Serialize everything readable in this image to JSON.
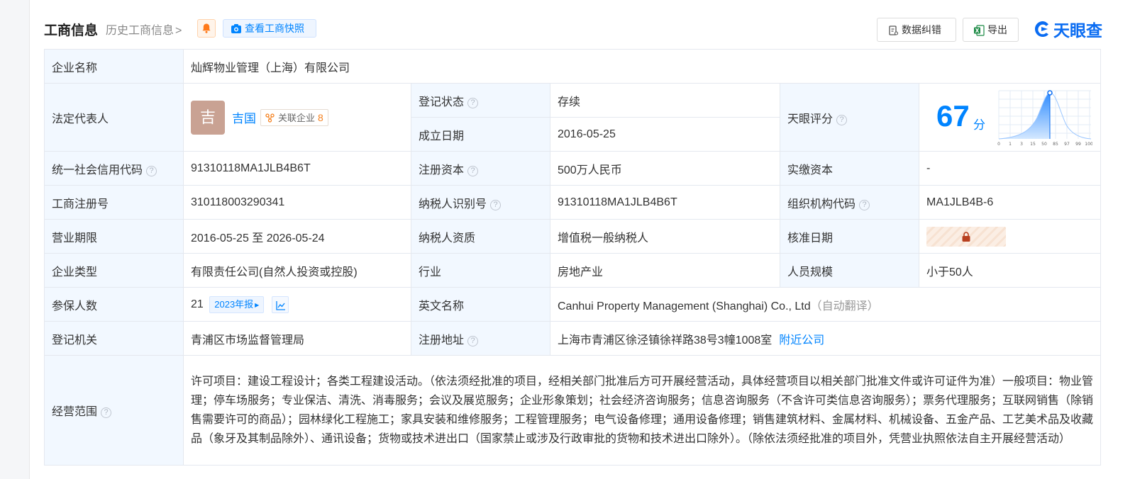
{
  "header": {
    "title": "工商信息",
    "history_link": "历史工商信息",
    "history_chevron": ">",
    "snapshot_button": "查看工商快照",
    "correct_button": "数据纠错",
    "export_button": "导出",
    "logo_text": "天眼查"
  },
  "colors": {
    "accent": "#0084ff",
    "label_bg": "#f2f8ff",
    "status_green": "#1aa33e",
    "orange": "#f58220"
  },
  "rows": {
    "company_name": {
      "label": "企业名称",
      "value": "灿辉物业管理（上海）有限公司"
    },
    "legal_rep": {
      "label": "法定代表人",
      "avatar_char": "吉",
      "name": "吉国",
      "related_label": "关联企业",
      "related_count": "8"
    },
    "reg_status": {
      "label": "登记状态",
      "value": "存续"
    },
    "founded": {
      "label": "成立日期",
      "value": "2016-05-25"
    },
    "tianyan_score": {
      "label": "天眼评分",
      "score": "67",
      "unit": "分",
      "ticks": [
        "0",
        "1",
        "3",
        "15",
        "50",
        "85",
        "97",
        "99",
        "100"
      ]
    },
    "credit_code": {
      "label": "统一社会信用代码",
      "value": "91310118MA1JLB4B6T"
    },
    "reg_capital": {
      "label": "注册资本",
      "value": "500万人民币"
    },
    "paid_capital": {
      "label": "实缴资本",
      "value": "-"
    },
    "reg_number": {
      "label": "工商注册号",
      "value": "310118003290341"
    },
    "taxpayer_id": {
      "label": "纳税人识别号",
      "value": "91310118MA1JLB4B6T"
    },
    "org_code": {
      "label": "组织机构代码",
      "value": "MA1JLB4B-6"
    },
    "business_term": {
      "label": "营业期限",
      "value": "2016-05-25 至 2026-05-24"
    },
    "taxpayer_qual": {
      "label": "纳税人资质",
      "value": "增值税一般纳税人"
    },
    "approval_date": {
      "label": "核准日期"
    },
    "company_type": {
      "label": "企业类型",
      "value": "有限责任公司(自然人投资或控股)"
    },
    "industry": {
      "label": "行业",
      "value": "房地产业"
    },
    "staff_size": {
      "label": "人员规模",
      "value": "小于50人"
    },
    "insured": {
      "label": "参保人数",
      "value": "21",
      "report_tag": "2023年报"
    },
    "english_name": {
      "label": "英文名称",
      "value": "Canhui Property Management (Shanghai) Co., Ltd",
      "note": "（自动翻译）"
    },
    "reg_authority": {
      "label": "登记机关",
      "value": "青浦区市场监督管理局"
    },
    "reg_address": {
      "label": "注册地址",
      "value": "上海市青浦区徐泾镇徐祥路38号3幢1008室",
      "nearby": "附近公司"
    },
    "scope": {
      "label": "经营范围",
      "value": "许可项目：建设工程设计；各类工程建设活动。（依法须经批准的项目，经相关部门批准后方可开展经营活动，具体经营项目以相关部门批准文件或许可证件为准）一般项目：物业管理；停车场服务；专业保洁、清洗、消毒服务；会议及展览服务；企业形象策划；社会经济咨询服务；信息咨询服务（不含许可类信息咨询服务）；票务代理服务；互联网销售（除销售需要许可的商品）；园林绿化工程施工；家具安装和维修服务；工程管理服务；电气设备修理；通用设备修理；销售建筑材料、金属材料、机械设备、五金产品、工艺美术品及收藏品（象牙及其制品除外）、通讯设备；货物或技术进出口（国家禁止或涉及行政审批的货物和技术进出口除外）。（除依法须经批准的项目外，凭营业执照依法自主开展经营活动）"
    }
  }
}
